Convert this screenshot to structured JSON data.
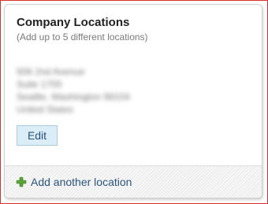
{
  "card": {
    "title": "Company Locations",
    "subtitle": "(Add up to 5 different locations)",
    "address": {
      "line1": "506 2nd Avenue",
      "line2": "Suite 1700",
      "line3": "Seattle, Washington 98104",
      "line4": "United States"
    },
    "edit_label": "Edit"
  },
  "footer": {
    "add_label": "Add another location",
    "icon": "plus-icon"
  },
  "colors": {
    "frame_border": "#d93030",
    "link": "#2a557f",
    "button_bg": "#dbeef8",
    "plus": "#5aa63a"
  }
}
